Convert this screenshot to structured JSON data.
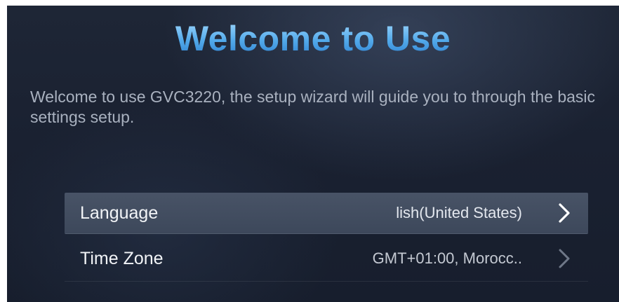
{
  "header": {
    "title": "Welcome to Use"
  },
  "intro": {
    "text": "Welcome to use GVC3220, the setup wizard will guide you to through the basic settings setup."
  },
  "settings": [
    {
      "label": "Language",
      "value": "lish(United States)",
      "icon": "chevron-right-icon",
      "selected": true
    },
    {
      "label": "Time Zone",
      "value": "GMT+01:00, Morocc..",
      "icon": "chevron-right-icon",
      "selected": false
    }
  ],
  "colors": {
    "title_gradient_top": "#a6dcff",
    "title_gradient_bottom": "#2c7fd0",
    "background": "#1a2131",
    "selected_row": "#485366",
    "text": "#f2f4f7",
    "description_text": "#a9b1bf"
  }
}
